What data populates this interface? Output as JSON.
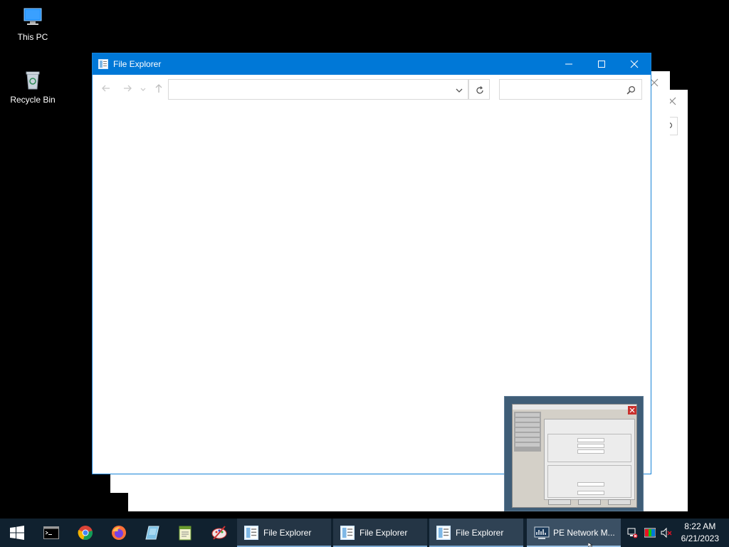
{
  "desktop": {
    "icons": [
      {
        "label": "This PC",
        "icon": "computer-icon"
      },
      {
        "label": "Recycle Bin",
        "icon": "recycle-bin-icon"
      }
    ]
  },
  "explorer": {
    "title": "File Explorer",
    "address_value": "",
    "search_value": ""
  },
  "taskbar": {
    "pinned": [
      {
        "name": "start-button",
        "icon": "windows-logo-icon"
      },
      {
        "name": "taskbar-cmd",
        "icon": "command-prompt-icon"
      },
      {
        "name": "taskbar-chrome",
        "icon": "chrome-icon"
      },
      {
        "name": "taskbar-firefox",
        "icon": "firefox-icon"
      },
      {
        "name": "taskbar-app4",
        "icon": "blue-app-icon"
      },
      {
        "name": "taskbar-app5",
        "icon": "notepad-icon"
      },
      {
        "name": "taskbar-app6",
        "icon": "paint-icon"
      }
    ],
    "windows": [
      {
        "label": "File Explorer",
        "icon": "file-explorer-icon"
      },
      {
        "label": "File Explorer",
        "icon": "file-explorer-icon"
      },
      {
        "label": "File Explorer",
        "icon": "file-explorer-icon"
      },
      {
        "label": "PE Network M...",
        "icon": "network-manager-icon"
      }
    ],
    "clock": {
      "time": "8:22 AM",
      "date": "6/21/2023"
    }
  },
  "thumbnail": {
    "window": "PE Network Manager preview"
  },
  "colors": {
    "accent": "#0078d7",
    "taskbar": "#10212f",
    "desktop": "#000000",
    "taskbar_active": "#3b5064"
  }
}
